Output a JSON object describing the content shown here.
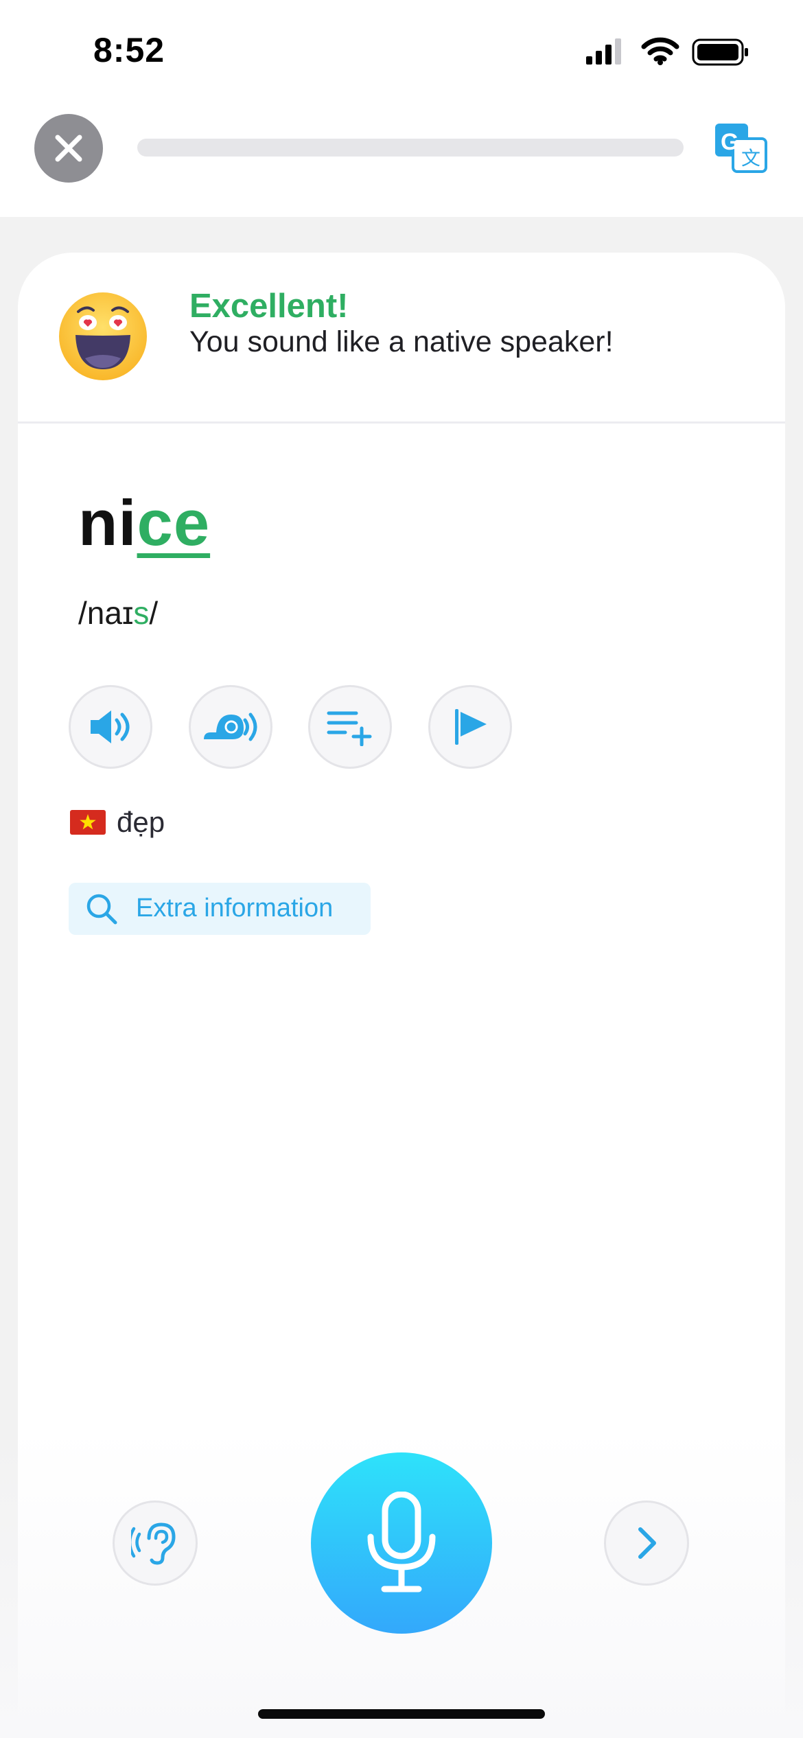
{
  "status_bar": {
    "time": "8:52"
  },
  "header": {
    "close_icon": "close-icon",
    "translate_icon": "translate-icon",
    "progress": 0.0,
    "accent_color": "#2aa6e6"
  },
  "feedback": {
    "title": "Excellent!",
    "message": "You sound like a native speaker!",
    "emoji": "heart-eyes-emoji",
    "color": "#2fae62"
  },
  "word": {
    "plain": "ni",
    "highlight": "ce",
    "ipa_before": "/naɪ",
    "ipa_highlight": "s",
    "ipa_after": "/"
  },
  "actions": [
    {
      "icon": "speaker-icon"
    },
    {
      "icon": "snail-slow-audio-icon"
    },
    {
      "icon": "add-to-list-icon"
    },
    {
      "icon": "flag-report-icon"
    }
  ],
  "translation": {
    "flag": "vietnam-flag",
    "text": "đẹp"
  },
  "extra_info": {
    "label": "Extra information",
    "icon": "search-icon"
  },
  "bottom": {
    "listen_icon": "ear-listen-icon",
    "mic_icon": "microphone-icon",
    "next_icon": "chevron-right-icon",
    "mic_gradient": [
      "#2ee2fa",
      "#33a8fb"
    ]
  }
}
